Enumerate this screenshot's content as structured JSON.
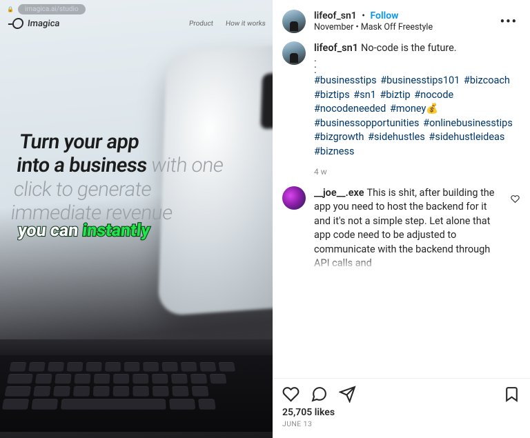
{
  "media": {
    "address_bar_url": "imagica.ai/studio",
    "brand": "Imagica",
    "nav": [
      "Product",
      "How it works"
    ],
    "headline_bold_1": "Turn your app",
    "headline_bold_2": "into a business",
    "headline_light_tail": " with one click to generate immediate revenue",
    "caption_white": "you can ",
    "caption_green": "instantly"
  },
  "header": {
    "username": "lifeof_sn1",
    "follow_label": "Follow",
    "subline_1": "November",
    "subline_separator": " • ",
    "subline_2": "Mask Off Freestyle"
  },
  "post": {
    "author": "lifeof_sn1",
    "text_lead": "No-code is the future.",
    "hashtags": [
      "#businesstips",
      "#businesstips101",
      "#bizcoach",
      "#biztips",
      "#sn1",
      "#biztip",
      "#nocode",
      "#nocodeneeded",
      "#money💰",
      "#businessopportunities",
      "#onlinebusinesstips",
      "#bizgrowth",
      "#sidehustles",
      "#sidehustleideas",
      "#bizness"
    ],
    "age": "4 w"
  },
  "comment": {
    "author": "__joe__.exe",
    "text": "This is shit, after building the app you need to host the backend for it and it's not a simple step. Let alone that app code need to be adjusted to communicate with the backend through API calls and"
  },
  "footer": {
    "likes_label": "25,705 likes",
    "date_label": "JUNE 13"
  }
}
